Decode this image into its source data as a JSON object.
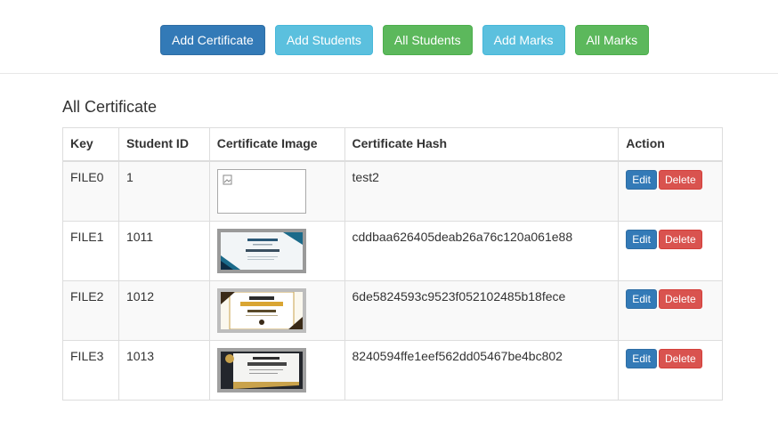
{
  "nav": {
    "buttons": [
      {
        "label": "Add Certificate"
      },
      {
        "label": "Add Students"
      },
      {
        "label": "All Students"
      },
      {
        "label": "Add Marks"
      },
      {
        "label": "All Marks"
      }
    ]
  },
  "page": {
    "title": "All Certificate"
  },
  "table": {
    "headers": [
      "Key",
      "Student ID",
      "Certificate Image",
      "Certificate Hash",
      "Action"
    ],
    "rows": [
      {
        "key": "FILE0",
        "student_id": "1",
        "hash": "test2",
        "image": "broken-image-icon"
      },
      {
        "key": "FILE1",
        "student_id": "1011",
        "hash": "cddbaa626405deab26a76c120a061e88",
        "image": "certificate-thumbnail"
      },
      {
        "key": "FILE2",
        "student_id": "1012",
        "hash": "6de5824593c9523f052102485b18fece",
        "image": "certificate-thumbnail"
      },
      {
        "key": "FILE3",
        "student_id": "1013",
        "hash": "8240594ffe1eef562dd05467be4bc802",
        "image": "certificate-thumbnail"
      }
    ],
    "edit_label": "Edit",
    "delete_label": "Delete"
  },
  "colors": {
    "primary": "#337ab7",
    "info": "#5bc0de",
    "success": "#5cb85c",
    "danger": "#d9534f"
  }
}
